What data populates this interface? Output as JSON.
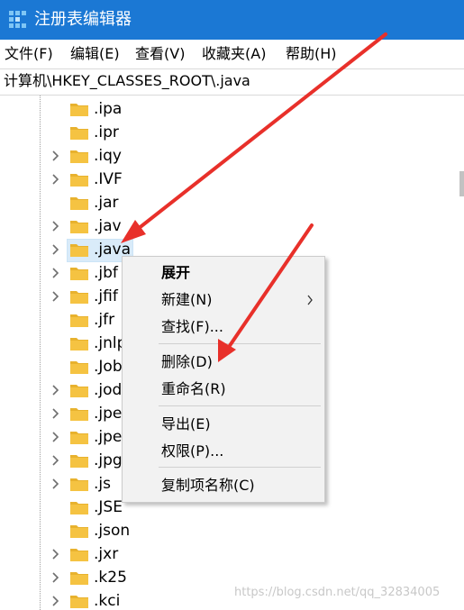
{
  "window": {
    "title": "注册表编辑器"
  },
  "menu": [
    "文件(F)",
    "编辑(E)",
    "查看(V)",
    "收藏夹(A)",
    "帮助(H)"
  ],
  "address": "计算机\\HKEY_CLASSES_ROOT\\.java",
  "tree": {
    "items": [
      {
        "label": ".ipa",
        "expandable": false
      },
      {
        "label": ".ipr",
        "expandable": false
      },
      {
        "label": ".iqy",
        "expandable": true
      },
      {
        "label": ".IVF",
        "expandable": true
      },
      {
        "label": ".jar",
        "expandable": false
      },
      {
        "label": ".jav",
        "expandable": true
      },
      {
        "label": ".java",
        "expandable": true,
        "selected": true
      },
      {
        "label": ".jbf",
        "expandable": true
      },
      {
        "label": ".jfif",
        "expandable": true
      },
      {
        "label": ".jfr",
        "expandable": false
      },
      {
        "label": ".jnlp",
        "expandable": false
      },
      {
        "label": ".Job",
        "expandable": false
      },
      {
        "label": ".jod",
        "expandable": true
      },
      {
        "label": ".jpe",
        "expandable": true
      },
      {
        "label": ".jpe",
        "expandable": true
      },
      {
        "label": ".jpg",
        "expandable": true
      },
      {
        "label": ".js",
        "expandable": true
      },
      {
        "label": ".JSE",
        "expandable": false
      },
      {
        "label": ".json",
        "expandable": false
      },
      {
        "label": ".jxr",
        "expandable": true
      },
      {
        "label": ".k25",
        "expandable": true
      },
      {
        "label": ".kci",
        "expandable": true
      }
    ]
  },
  "context_menu": {
    "items": [
      {
        "label": "展开",
        "bold": true
      },
      {
        "label": "新建(N)",
        "submenu": true
      },
      {
        "label": "查找(F)..."
      },
      {
        "label": "删除(D)"
      },
      {
        "label": "重命名(R)"
      },
      {
        "label": "导出(E)"
      },
      {
        "label": "权限(P)..."
      },
      {
        "label": "复制项名称(C)"
      }
    ]
  },
  "watermark": "https://blog.csdn.net/qq_32834005",
  "colors": {
    "titlebar": "#1b78d4",
    "selection": "#d9ebf9",
    "menu_bg": "#f2f2f2",
    "folder": "#f5c342",
    "annotation_arrow": "#e8302a"
  },
  "icons": {
    "app": "registry-editor-icon",
    "tree_expand": "chevron-right-icon",
    "tree_item": "folder-icon",
    "submenu": "chevron-right-icon"
  }
}
